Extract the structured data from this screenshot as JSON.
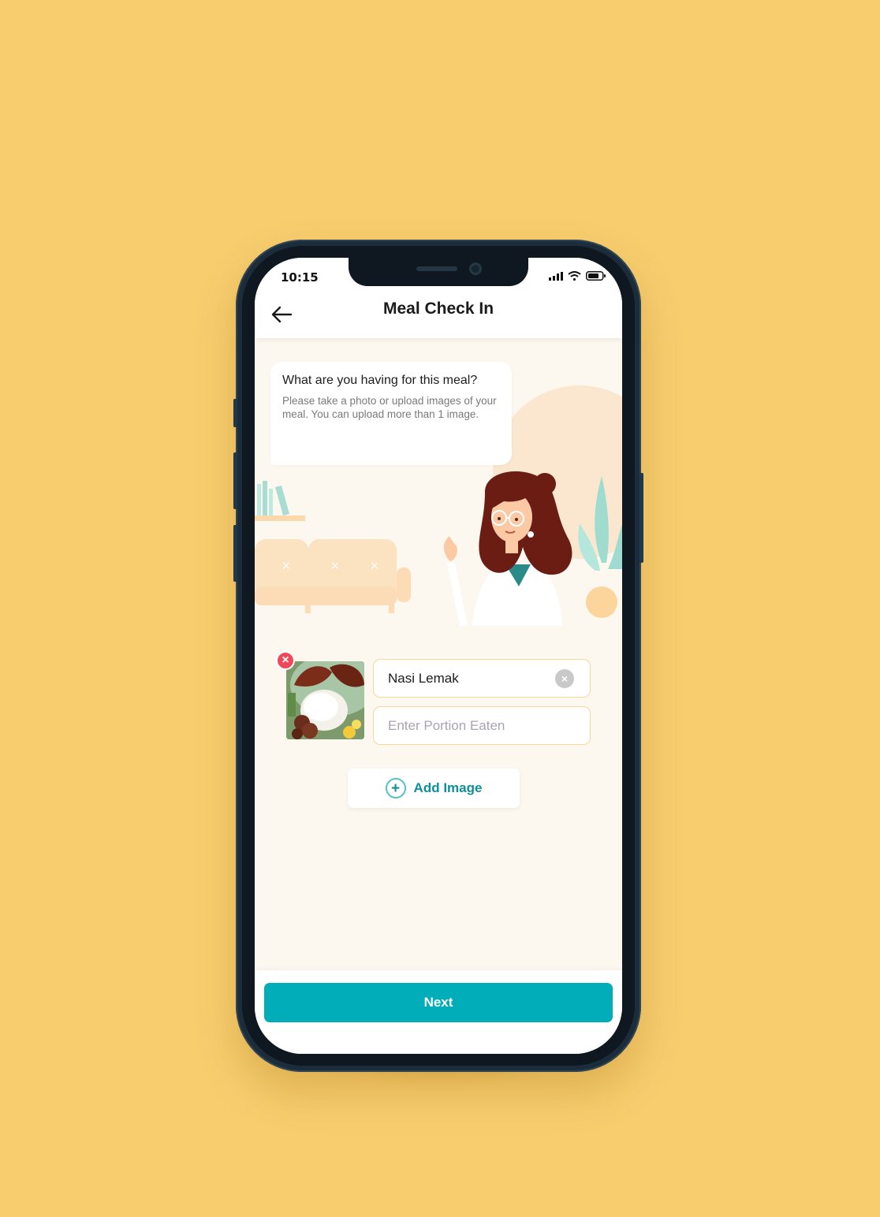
{
  "status_bar": {
    "time": "10:15",
    "icons": [
      "signal-icon",
      "wifi-icon",
      "battery-icon"
    ]
  },
  "header": {
    "back_icon": "arrow-left-icon",
    "title": "Meal Check In"
  },
  "prompt": {
    "title": "What are you having for this meal?",
    "subtitle": "Please take a photo or upload images of your meal. You can upload more than 1 image."
  },
  "meal": {
    "image_alt": "meal-photo",
    "food_name_value": "Nasi Lemak",
    "portion_placeholder": "Enter Portion Eaten"
  },
  "actions": {
    "add_image_label": "Add Image",
    "next_label": "Next"
  },
  "colors": {
    "background": "#f7cd6e",
    "accent": "#00adb9",
    "accent_text": "#0e8e98",
    "remove": "#f0485b",
    "field_border": "#f5d79b"
  }
}
